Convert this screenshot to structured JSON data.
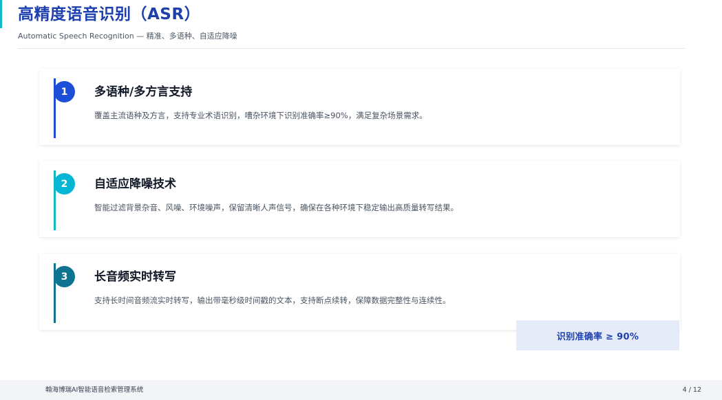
{
  "header": {
    "title": "高精度语音识别（ASR）",
    "subtitle": "Automatic Speech Recognition — 精准、多语种、自适应降噪",
    "accent_color": "#14b8c4",
    "title_color": "#1e40af"
  },
  "features": [
    {
      "number": "1",
      "title": "多语种/多方言支持",
      "description": "覆盖主流语种及方言，支持专业术语识别，嘈杂环境下识别准确率≥90%，满足复杂场景需求。",
      "color": "#1d4ed8"
    },
    {
      "number": "2",
      "title": "自适应降噪技术",
      "description": "智能过滤背景杂音、风噪、环境噪声，保留清晰人声信号，确保在各种环境下稳定输出高质量转写结果。",
      "color": "#06b6d4"
    },
    {
      "number": "3",
      "title": "长音频实时转写",
      "description": "支持长时间音频流实时转写，输出带毫秒级时间戳的文本，支持断点续转，保障数据完整性与连续性。",
      "color": "#0e7490"
    }
  ],
  "callout": {
    "text": "识别准确率 ≥ 90%",
    "background": "#e5ecf8"
  },
  "footer": {
    "system_name": "翰海博瑞AI智能语音检索管理系统",
    "page_indicator": "4 / 12"
  }
}
